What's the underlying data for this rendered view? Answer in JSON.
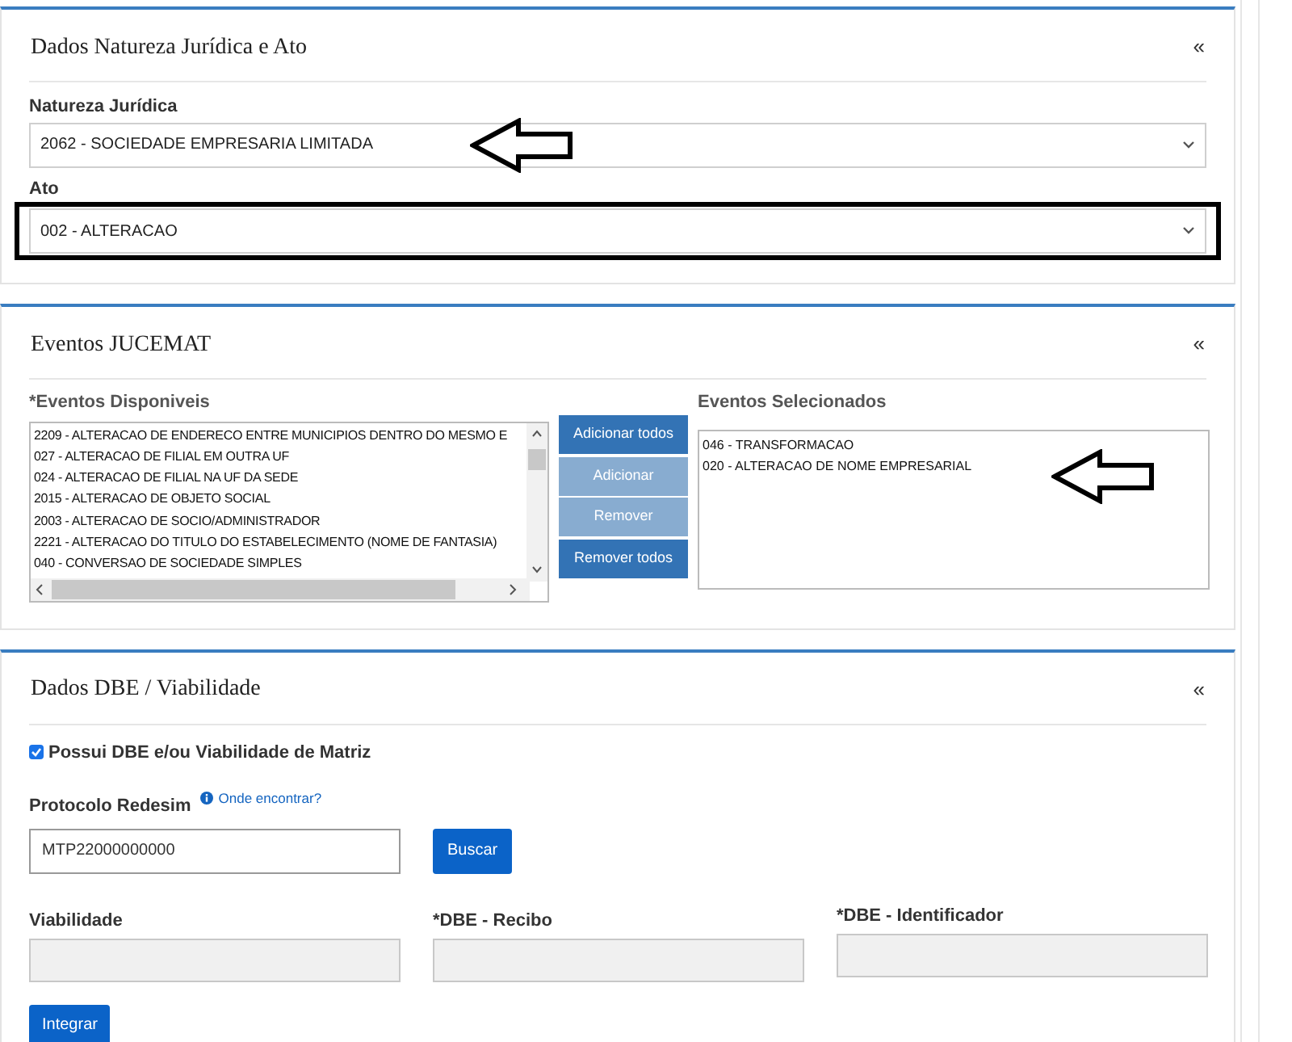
{
  "natureza_panel": {
    "title": "Dados Natureza Jurídica e Ato",
    "collapse": "«",
    "natureza": {
      "label": "Natureza Jurídica",
      "value": "2062 - SOCIEDADE EMPRESARIA LIMITADA",
      "annotated": true
    },
    "ato": {
      "label": "Ato",
      "value": "002 - ALTERACAO",
      "highlighted": true
    }
  },
  "eventos_panel": {
    "title": "Eventos JUCEMAT",
    "collapse": "«",
    "disponiveis": {
      "label": "*Eventos Disponiveis",
      "items": [
        "2209 - ALTERACAO DE ENDERECO ENTRE MUNICIPIOS DENTRO DO MESMO E",
        "027 - ALTERACAO DE FILIAL EM OUTRA UF",
        "024 - ALTERACAO DE FILIAL NA UF DA SEDE",
        "2015 - ALTERACAO DE OBJETO SOCIAL",
        "2003 - ALTERACAO DE SOCIO/ADMINISTRADOR",
        "2221 - ALTERACAO DO TITULO DO ESTABELECIMENTO (NOME DE FANTASIA)",
        "040 - CONVERSAO DE SOCIEDADE SIMPLES"
      ]
    },
    "buttons": [
      {
        "label": "Adicionar todos",
        "disabled": false
      },
      {
        "label": "Adicionar",
        "disabled": true
      },
      {
        "label": "Remover",
        "disabled": true
      },
      {
        "label": "Remover todos",
        "disabled": false
      }
    ],
    "selecionados": {
      "label": "Eventos Selecionados",
      "annotated": true,
      "items": [
        "046 - TRANSFORMACAO",
        "020 - ALTERACAO DE NOME EMPRESARIAL"
      ]
    }
  },
  "dbe_panel": {
    "title": "Dados DBE / Viabilidade",
    "collapse": "«",
    "checkbox": {
      "label": "Possui DBE e/ou Viabilidade de Matriz",
      "checked": true
    },
    "protocolo": {
      "label": "Protocolo Redesim",
      "help_link": "Onde encontrar?",
      "value": "MTP22000000000"
    },
    "search_button": "Buscar",
    "fields": [
      {
        "label": "Viabilidade"
      },
      {
        "label": "*DBE - Recibo"
      },
      {
        "label": "*DBE - Identificador"
      }
    ],
    "submit_button": "Integrar"
  }
}
